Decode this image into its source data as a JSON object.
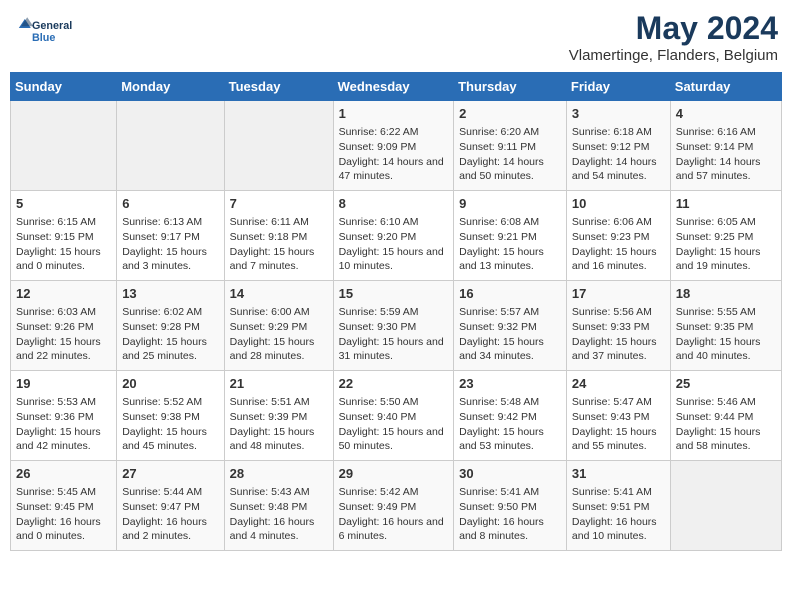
{
  "header": {
    "logo_line1": "General",
    "logo_line2": "Blue",
    "month_title": "May 2024",
    "location": "Vlamertinge, Flanders, Belgium"
  },
  "days_of_week": [
    "Sunday",
    "Monday",
    "Tuesday",
    "Wednesday",
    "Thursday",
    "Friday",
    "Saturday"
  ],
  "weeks": [
    {
      "cells": [
        {
          "day": null
        },
        {
          "day": null
        },
        {
          "day": null
        },
        {
          "day": "1",
          "sunrise": "Sunrise: 6:22 AM",
          "sunset": "Sunset: 9:09 PM",
          "daylight": "Daylight: 14 hours and 47 minutes."
        },
        {
          "day": "2",
          "sunrise": "Sunrise: 6:20 AM",
          "sunset": "Sunset: 9:11 PM",
          "daylight": "Daylight: 14 hours and 50 minutes."
        },
        {
          "day": "3",
          "sunrise": "Sunrise: 6:18 AM",
          "sunset": "Sunset: 9:12 PM",
          "daylight": "Daylight: 14 hours and 54 minutes."
        },
        {
          "day": "4",
          "sunrise": "Sunrise: 6:16 AM",
          "sunset": "Sunset: 9:14 PM",
          "daylight": "Daylight: 14 hours and 57 minutes."
        }
      ]
    },
    {
      "cells": [
        {
          "day": "5",
          "sunrise": "Sunrise: 6:15 AM",
          "sunset": "Sunset: 9:15 PM",
          "daylight": "Daylight: 15 hours and 0 minutes."
        },
        {
          "day": "6",
          "sunrise": "Sunrise: 6:13 AM",
          "sunset": "Sunset: 9:17 PM",
          "daylight": "Daylight: 15 hours and 3 minutes."
        },
        {
          "day": "7",
          "sunrise": "Sunrise: 6:11 AM",
          "sunset": "Sunset: 9:18 PM",
          "daylight": "Daylight: 15 hours and 7 minutes."
        },
        {
          "day": "8",
          "sunrise": "Sunrise: 6:10 AM",
          "sunset": "Sunset: 9:20 PM",
          "daylight": "Daylight: 15 hours and 10 minutes."
        },
        {
          "day": "9",
          "sunrise": "Sunrise: 6:08 AM",
          "sunset": "Sunset: 9:21 PM",
          "daylight": "Daylight: 15 hours and 13 minutes."
        },
        {
          "day": "10",
          "sunrise": "Sunrise: 6:06 AM",
          "sunset": "Sunset: 9:23 PM",
          "daylight": "Daylight: 15 hours and 16 minutes."
        },
        {
          "day": "11",
          "sunrise": "Sunrise: 6:05 AM",
          "sunset": "Sunset: 9:25 PM",
          "daylight": "Daylight: 15 hours and 19 minutes."
        }
      ]
    },
    {
      "cells": [
        {
          "day": "12",
          "sunrise": "Sunrise: 6:03 AM",
          "sunset": "Sunset: 9:26 PM",
          "daylight": "Daylight: 15 hours and 22 minutes."
        },
        {
          "day": "13",
          "sunrise": "Sunrise: 6:02 AM",
          "sunset": "Sunset: 9:28 PM",
          "daylight": "Daylight: 15 hours and 25 minutes."
        },
        {
          "day": "14",
          "sunrise": "Sunrise: 6:00 AM",
          "sunset": "Sunset: 9:29 PM",
          "daylight": "Daylight: 15 hours and 28 minutes."
        },
        {
          "day": "15",
          "sunrise": "Sunrise: 5:59 AM",
          "sunset": "Sunset: 9:30 PM",
          "daylight": "Daylight: 15 hours and 31 minutes."
        },
        {
          "day": "16",
          "sunrise": "Sunrise: 5:57 AM",
          "sunset": "Sunset: 9:32 PM",
          "daylight": "Daylight: 15 hours and 34 minutes."
        },
        {
          "day": "17",
          "sunrise": "Sunrise: 5:56 AM",
          "sunset": "Sunset: 9:33 PM",
          "daylight": "Daylight: 15 hours and 37 minutes."
        },
        {
          "day": "18",
          "sunrise": "Sunrise: 5:55 AM",
          "sunset": "Sunset: 9:35 PM",
          "daylight": "Daylight: 15 hours and 40 minutes."
        }
      ]
    },
    {
      "cells": [
        {
          "day": "19",
          "sunrise": "Sunrise: 5:53 AM",
          "sunset": "Sunset: 9:36 PM",
          "daylight": "Daylight: 15 hours and 42 minutes."
        },
        {
          "day": "20",
          "sunrise": "Sunrise: 5:52 AM",
          "sunset": "Sunset: 9:38 PM",
          "daylight": "Daylight: 15 hours and 45 minutes."
        },
        {
          "day": "21",
          "sunrise": "Sunrise: 5:51 AM",
          "sunset": "Sunset: 9:39 PM",
          "daylight": "Daylight: 15 hours and 48 minutes."
        },
        {
          "day": "22",
          "sunrise": "Sunrise: 5:50 AM",
          "sunset": "Sunset: 9:40 PM",
          "daylight": "Daylight: 15 hours and 50 minutes."
        },
        {
          "day": "23",
          "sunrise": "Sunrise: 5:48 AM",
          "sunset": "Sunset: 9:42 PM",
          "daylight": "Daylight: 15 hours and 53 minutes."
        },
        {
          "day": "24",
          "sunrise": "Sunrise: 5:47 AM",
          "sunset": "Sunset: 9:43 PM",
          "daylight": "Daylight: 15 hours and 55 minutes."
        },
        {
          "day": "25",
          "sunrise": "Sunrise: 5:46 AM",
          "sunset": "Sunset: 9:44 PM",
          "daylight": "Daylight: 15 hours and 58 minutes."
        }
      ]
    },
    {
      "cells": [
        {
          "day": "26",
          "sunrise": "Sunrise: 5:45 AM",
          "sunset": "Sunset: 9:45 PM",
          "daylight": "Daylight: 16 hours and 0 minutes."
        },
        {
          "day": "27",
          "sunrise": "Sunrise: 5:44 AM",
          "sunset": "Sunset: 9:47 PM",
          "daylight": "Daylight: 16 hours and 2 minutes."
        },
        {
          "day": "28",
          "sunrise": "Sunrise: 5:43 AM",
          "sunset": "Sunset: 9:48 PM",
          "daylight": "Daylight: 16 hours and 4 minutes."
        },
        {
          "day": "29",
          "sunrise": "Sunrise: 5:42 AM",
          "sunset": "Sunset: 9:49 PM",
          "daylight": "Daylight: 16 hours and 6 minutes."
        },
        {
          "day": "30",
          "sunrise": "Sunrise: 5:41 AM",
          "sunset": "Sunset: 9:50 PM",
          "daylight": "Daylight: 16 hours and 8 minutes."
        },
        {
          "day": "31",
          "sunrise": "Sunrise: 5:41 AM",
          "sunset": "Sunset: 9:51 PM",
          "daylight": "Daylight: 16 hours and 10 minutes."
        },
        {
          "day": null
        }
      ]
    }
  ]
}
